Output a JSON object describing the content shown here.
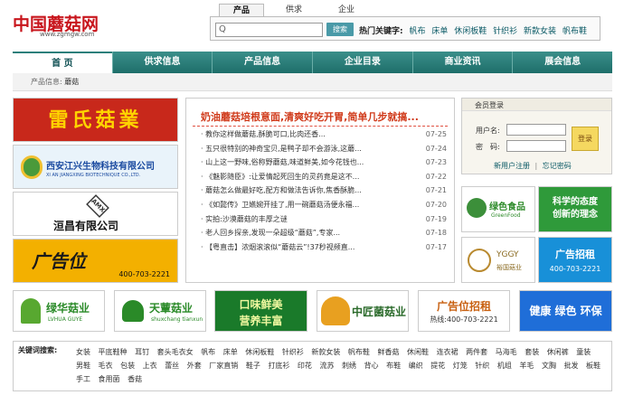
{
  "header": {
    "logo_text": "中国蘑菇网",
    "logo_url": "www.zgmgw.com",
    "tabs": [
      "产品",
      "供求",
      "企业"
    ],
    "search_placeholder": "Q",
    "search_button": "搜索",
    "hot_label": "热门关键字:",
    "hot_words": [
      "帆布",
      "床单",
      "休闲板鞋",
      "针织衫",
      "新款女装",
      "帆布鞋"
    ]
  },
  "nav": {
    "items": [
      "首 页",
      "供求信息",
      "产品信息",
      "企业目录",
      "商业资讯",
      "展会信息"
    ]
  },
  "breadcrumb": {
    "prefix": "产品信息:",
    "current": "蘑菇"
  },
  "left_ads": {
    "ad1": "雷氏菇業",
    "ad2_title": "西安江兴生物科技有限公司",
    "ad2_en": "XI AN JIANGXING BIOTECHNIQUE CO.,LTD.",
    "ad3_mark": "AMX",
    "ad3_title": "洹昌有限公司",
    "ad4_title": "广告位",
    "ad4_phone": "400-703-2221"
  },
  "news": {
    "headline": "奶油蘑菇培根意面,清爽好吃开胃,简单几步就搞...",
    "items": [
      {
        "title": "· 教你这样做蘑菇,酥脆可口,比肉还香...",
        "date": "07-25"
      },
      {
        "title": "· 五只很特别的神奇宝贝,是鸭子却不会游泳,这蘑...",
        "date": "07-24"
      },
      {
        "title": "· 山上这一野味,俗称野蘑菇,味道鲜美,如今花钱也...",
        "date": "07-23"
      },
      {
        "title": "· 《魅影随臣》:让爱情起死回生的灵药竟是这不...",
        "date": "07-22"
      },
      {
        "title": "· 蘑菇怎么做最好吃,配方和做法告诉你,焦香酥脆...",
        "date": "07-21"
      },
      {
        "title": "· 《如懿传》卫嬿婉开挂了,用一碗蘑菇汤便永福...",
        "date": "07-20"
      },
      {
        "title": "· 实拍:沙漠蘑菇的丰厚之谜",
        "date": "07-19"
      },
      {
        "title": "· 老人回乡探亲,发现一朵超级“蘑菇”,专家...",
        "date": "07-18"
      },
      {
        "title": "· 【粤直击】浓烟滚滚似“蘑菇云”!37秒视频直...",
        "date": "07-17"
      }
    ]
  },
  "login": {
    "title": "会员登录",
    "username_label": "用户名:",
    "password_label": "密　码:",
    "button": "登录",
    "register": "新用户注册",
    "forgot": "忘记密码",
    "separator": "|"
  },
  "right_ads": {
    "ra1_title": "绿色食品",
    "ra1_en": "GreenFood",
    "ra2_line1": "科学的态度",
    "ra2_line2": "创新的理念",
    "ra3_title": "YGGY",
    "ra3_sub": "裕国菇业",
    "ra4_title": "广告招租",
    "ra4_phone": "400-703-2221"
  },
  "bottom_banners": {
    "b1_title": "绿华菇业",
    "b1_en": "LVHUA GUYE",
    "b2_title": "天蕈菇业",
    "b2_en": "shuxchang tianxun",
    "b3_line1": "口味鲜美",
    "b3_line2": "营养丰富",
    "b4_title": "中匠菌菇业",
    "b5_title": "广告位招租",
    "b5_phone": "热线:400-703-2221",
    "b6_title": "健康 绿色 环保"
  },
  "keywords": {
    "label": "关键词搜索:",
    "items": [
      "女装",
      "平底鞋种",
      "耳钉",
      "套头毛衣女",
      "帆布",
      "床单",
      "休闲板鞋",
      "针织衫",
      "新款女装",
      "帆布鞋",
      "鲜香菇",
      "休闲鞋",
      "连衣裙",
      "两件套",
      "马海毛",
      "套装",
      "休闲裤",
      "童装",
      "男鞋",
      "毛衣",
      "包装",
      "上衣",
      "蕾丝",
      "外套",
      "厂家直销",
      "鞋子",
      "打底衫",
      "印花",
      "流苏",
      "刺绣",
      "背心",
      "布鞋",
      "编织",
      "提花",
      "灯笼",
      "针织",
      "机组",
      "羊毛",
      "文胸",
      "批发",
      "板鞋",
      "手工",
      "食用菌",
      "香菇"
    ]
  }
}
